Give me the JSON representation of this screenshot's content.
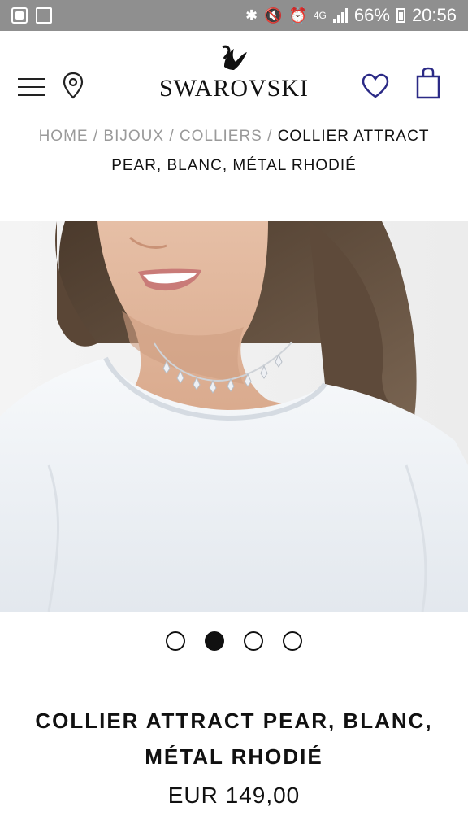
{
  "status_bar": {
    "battery": "66%",
    "time": "20:56",
    "network": "4G"
  },
  "header": {
    "logo": "SWAROVSKI",
    "icons": [
      "menu-icon",
      "location-pin-icon",
      "heart-icon",
      "shopping-bag-icon"
    ]
  },
  "breadcrumb": {
    "items": [
      "HOME",
      "BIJOUX",
      "COLLIERS"
    ],
    "current": "COLLIER ATTRACT PEAR, BLANC, MÉTAL RHODIÉ",
    "separator": "/"
  },
  "carousel": {
    "total": 4,
    "active_index": 1
  },
  "product": {
    "title": "COLLIER ATTRACT PEAR, BLANC, MÉTAL RHODIÉ",
    "price": "EUR 149,00"
  },
  "colors": {
    "status_bar_bg": "#8f8f8f",
    "accent_icon": "#2b2a86",
    "breadcrumb_link": "#9a9a9a",
    "text": "#111111"
  }
}
